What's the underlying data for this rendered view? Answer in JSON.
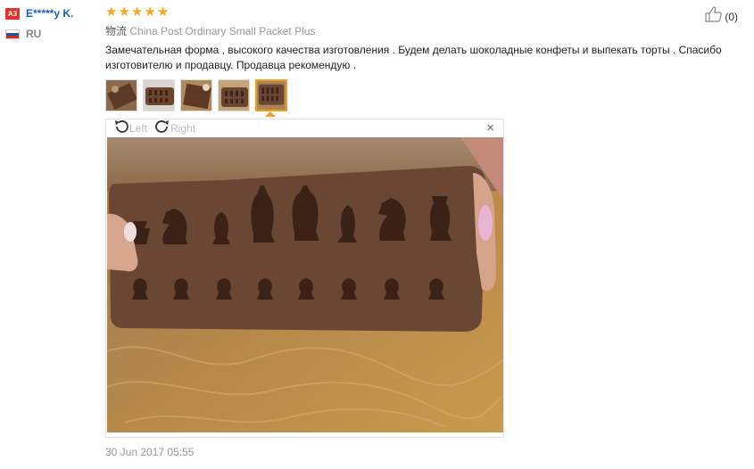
{
  "review": {
    "user": {
      "badge": "A3",
      "name": "E*****y K.",
      "country": "RU"
    },
    "rating": 5,
    "likes": "(0)",
    "logistics_label": "物流",
    "logistics_value": "China Post Ordinary Small Packet Plus",
    "text": "Замечательная форма , высокого качества изготовления . Будем делать шоколадные конфеты и выпекать торты . Спасибо изготовителю и продавцу. Продавца рекомендую .",
    "date": "30 Jun 2017 05:55"
  },
  "viewer": {
    "rotate_left": "Left",
    "rotate_right": "Right",
    "close": "×"
  },
  "icons": {
    "star": "star-icon",
    "like": "thumbs-up-icon",
    "rotate_left": "rotate-left-icon",
    "rotate_right": "rotate-right-icon",
    "close": "close-icon"
  },
  "colors": {
    "star": "#f6a623",
    "username": "#1a5ebd",
    "active_thumb": "#f39c2b",
    "badge": "#e43226"
  }
}
